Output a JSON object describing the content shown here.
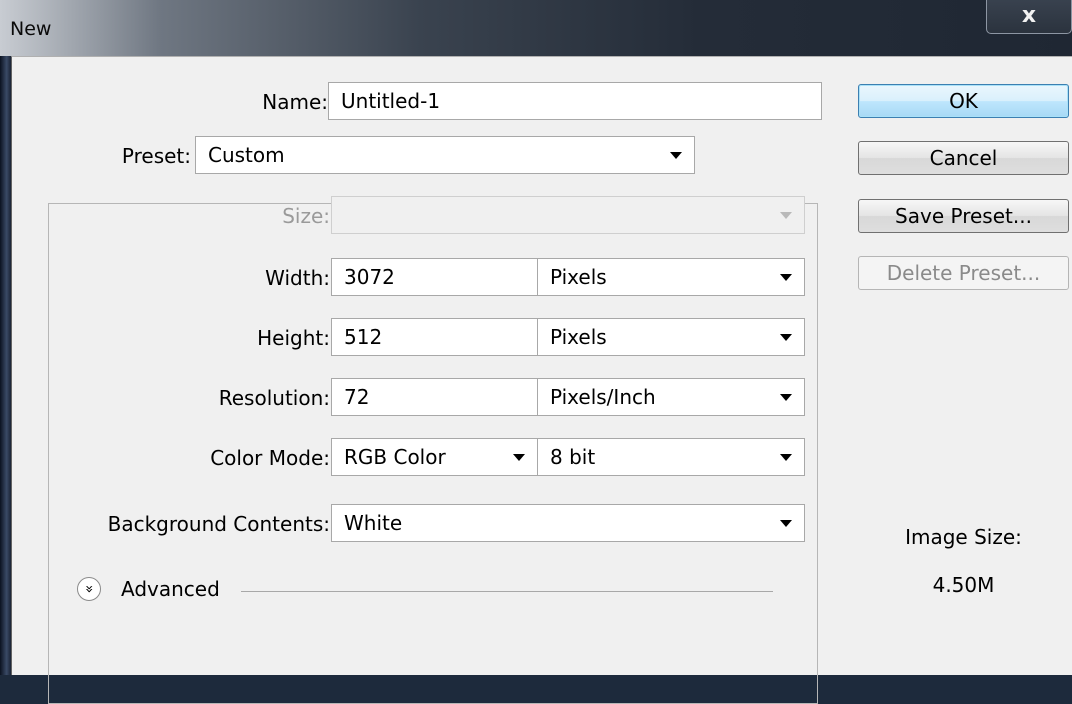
{
  "window": {
    "title": "New",
    "close_label": "x"
  },
  "form": {
    "name_label": "Name:",
    "name_value": "Untitled-1",
    "preset_label": "Preset:",
    "preset_value": "Custom",
    "size_label": "Size:",
    "size_value": "",
    "width_label": "Width:",
    "width_value": "3072",
    "width_unit": "Pixels",
    "height_label": "Height:",
    "height_value": "512",
    "height_unit": "Pixels",
    "resolution_label": "Resolution:",
    "resolution_value": "72",
    "resolution_unit": "Pixels/Inch",
    "color_mode_label": "Color Mode:",
    "color_mode_value": "RGB Color",
    "bit_depth_value": "8 bit",
    "background_label": "Background Contents:",
    "background_value": "White",
    "advanced_label": "Advanced"
  },
  "buttons": {
    "ok": "OK",
    "cancel": "Cancel",
    "save_preset": "Save Preset...",
    "delete_preset": "Delete Preset..."
  },
  "image_size": {
    "label": "Image Size:",
    "value": "4.50M"
  },
  "icons": {
    "advanced": "double-chevron-down-icon",
    "dropdown": "dropdown-arrow-icon",
    "close": "close-icon"
  }
}
